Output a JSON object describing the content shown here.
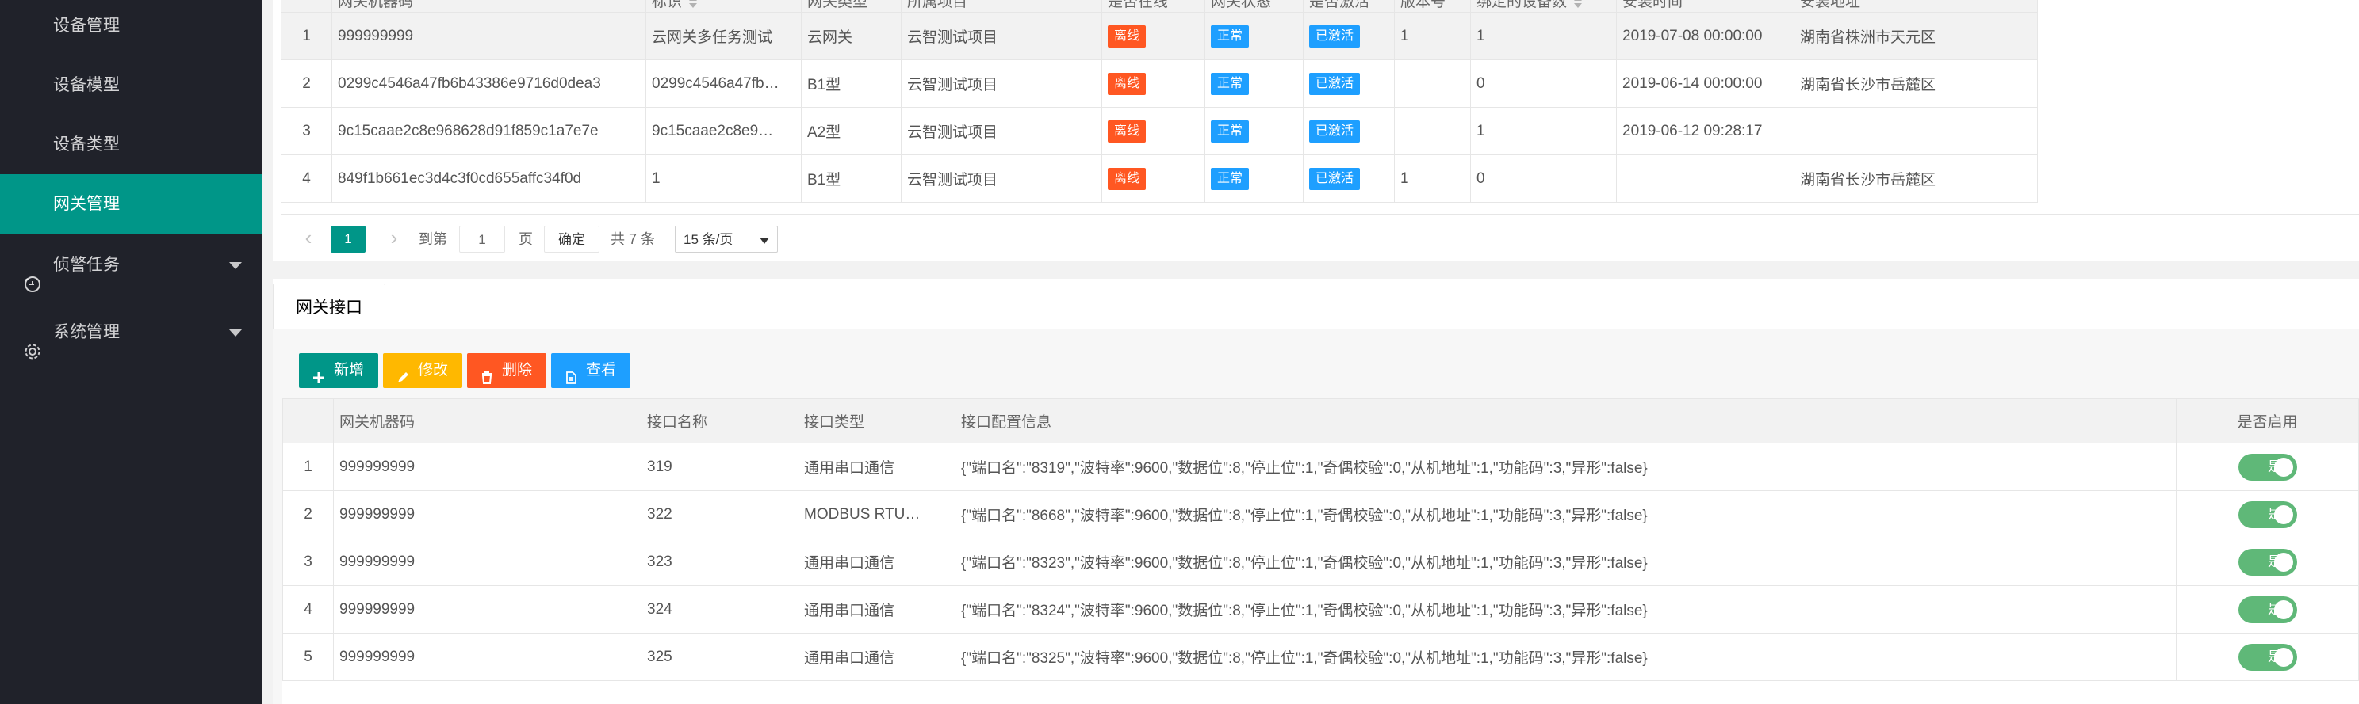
{
  "sidebar": {
    "sub_items": [
      {
        "label": "设备管理",
        "active": false
      },
      {
        "label": "设备模型",
        "active": false
      },
      {
        "label": "设备类型",
        "active": false
      },
      {
        "label": "网关管理",
        "active": true
      }
    ],
    "groups": [
      {
        "label": "侦警任务",
        "icon": "alarm-task-icon"
      },
      {
        "label": "系统管理",
        "icon": "gear-icon"
      }
    ]
  },
  "gateway_table": {
    "headers": [
      "网关机器码",
      "标识",
      "网关类型",
      "所属项目",
      "是否在线",
      "网关状态",
      "是否激活",
      "版本号",
      "绑定的设备数",
      "安装时间",
      "安装地址"
    ],
    "rows": [
      {
        "no": "1",
        "code": "999999999",
        "tag": "云网关多任务测试",
        "type": "云网关",
        "project": "云智测试项目",
        "online": "离线",
        "status": "正常",
        "active": "已激活",
        "version": "1",
        "devices": "1",
        "time": "2019-07-08 00:00:00",
        "address": "湖南省株洲市天元区"
      },
      {
        "no": "2",
        "code": "0299c4546a47fb6b43386e9716d0dea3",
        "tag": "0299c4546a47fb…",
        "type": "B1型",
        "project": "云智测试项目",
        "online": "离线",
        "status": "正常",
        "active": "已激活",
        "version": "",
        "devices": "0",
        "time": "2019-06-14 00:00:00",
        "address": "湖南省长沙市岳麓区"
      },
      {
        "no": "3",
        "code": "9c15caae2c8e968628d91f859c1a7e7e",
        "tag": "9c15caae2c8e9…",
        "type": "A2型",
        "project": "云智测试项目",
        "online": "离线",
        "status": "正常",
        "active": "已激活",
        "version": "",
        "devices": "1",
        "time": "2019-06-12 09:28:17",
        "address": ""
      },
      {
        "no": "4",
        "code": "849f1b661ec3d4c3f0cd655affc34f0d",
        "tag": "1",
        "type": "B1型",
        "project": "云智测试项目",
        "online": "离线",
        "status": "正常",
        "active": "已激活",
        "version": "1",
        "devices": "0",
        "time": "",
        "address": "湖南省长沙市岳麓区"
      }
    ]
  },
  "pager": {
    "prev": "‹",
    "current": "1",
    "next": "›",
    "goto_label": "到第",
    "goto_value": "1",
    "page_unit": "页",
    "confirm": "确定",
    "total": "共 7 条",
    "page_size": "15 条/页"
  },
  "tabs": [
    {
      "label": "网关接口"
    }
  ],
  "toolbar": {
    "add": "新增",
    "edit": "修改",
    "delete": "删除",
    "view": "查看"
  },
  "interface_table": {
    "headers": [
      "网关机器码",
      "接口名称",
      "接口类型",
      "接口配置信息",
      "是否启用"
    ],
    "rows": [
      {
        "no": "1",
        "code": "999999999",
        "name": "319",
        "type": "通用串口通信",
        "config": "{\"端口名\":\"8319\",\"波特率\":9600,\"数据位\":8,\"停止位\":1,\"奇偶校验\":0,\"从机地址\":1,\"功能码\":3,\"异形\":false}",
        "enabled": "是"
      },
      {
        "no": "2",
        "code": "999999999",
        "name": "322",
        "type": "MODBUS RTU…",
        "config": "{\"端口名\":\"8668\",\"波特率\":9600,\"数据位\":8,\"停止位\":1,\"奇偶校验\":0,\"从机地址\":1,\"功能码\":3,\"异形\":false}",
        "enabled": "是"
      },
      {
        "no": "3",
        "code": "999999999",
        "name": "323",
        "type": "通用串口通信",
        "config": "{\"端口名\":\"8323\",\"波特率\":9600,\"数据位\":8,\"停止位\":1,\"奇偶校验\":0,\"从机地址\":1,\"功能码\":3,\"异形\":false}",
        "enabled": "是"
      },
      {
        "no": "4",
        "code": "999999999",
        "name": "324",
        "type": "通用串口通信",
        "config": "{\"端口名\":\"8324\",\"波特率\":9600,\"数据位\":8,\"停止位\":1,\"奇偶校验\":0,\"从机地址\":1,\"功能码\":3,\"异形\":false}",
        "enabled": "是"
      },
      {
        "no": "5",
        "code": "999999999",
        "name": "325",
        "type": "通用串口通信",
        "config": "{\"端口名\":\"8325\",\"波特率\":9600,\"数据位\":8,\"停止位\":1,\"奇偶校验\":0,\"从机地址\":1,\"功能码\":3,\"异形\":false}",
        "enabled": "是"
      }
    ]
  },
  "colors": {
    "accent": "#009688",
    "sidebar_bg": "#20222a",
    "danger": "#ff5722",
    "warning": "#ffb800",
    "info": "#1e9fff",
    "toggle_on": "#5fb878"
  }
}
